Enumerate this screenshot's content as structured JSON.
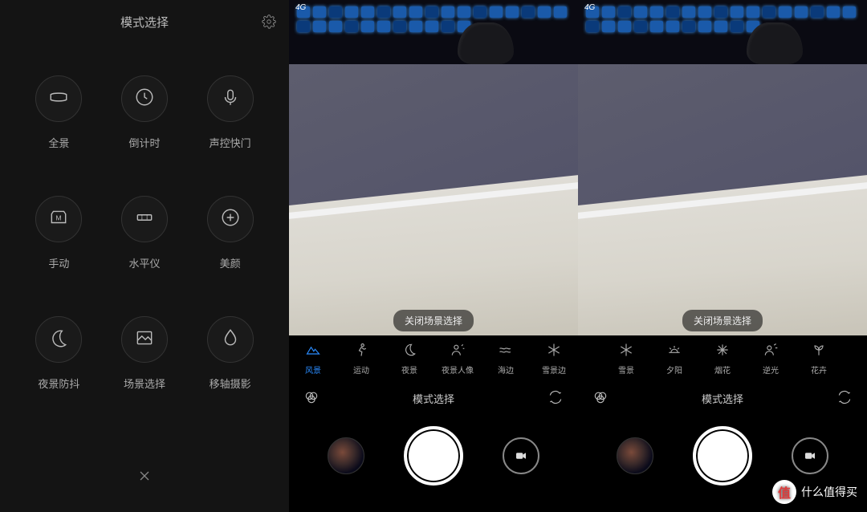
{
  "left": {
    "title": "模式选择",
    "modes": [
      "全景",
      "倒计时",
      "声控快门",
      "手动",
      "水平仪",
      "美颜",
      "夜景防抖",
      "场景选择",
      "移轴摄影"
    ]
  },
  "camera": {
    "status": "4G",
    "close_scene": "关闭场景选择",
    "mode_row": "模式选择"
  },
  "scenes_mid": [
    {
      "label": "风景",
      "active": true
    },
    {
      "label": "运动",
      "active": false
    },
    {
      "label": "夜景",
      "active": false
    },
    {
      "label": "夜景人像",
      "active": false
    },
    {
      "label": "海边",
      "active": false
    },
    {
      "label": "雪景边",
      "active": false
    }
  ],
  "scenes_right": [
    {
      "label": "雪景",
      "active": false
    },
    {
      "label": "夕阳",
      "active": false
    },
    {
      "label": "烟花",
      "active": false
    },
    {
      "label": "逆光",
      "active": false
    },
    {
      "label": "花卉",
      "active": false
    }
  ],
  "watermark": {
    "badge": "值",
    "text": "什么值得买"
  }
}
